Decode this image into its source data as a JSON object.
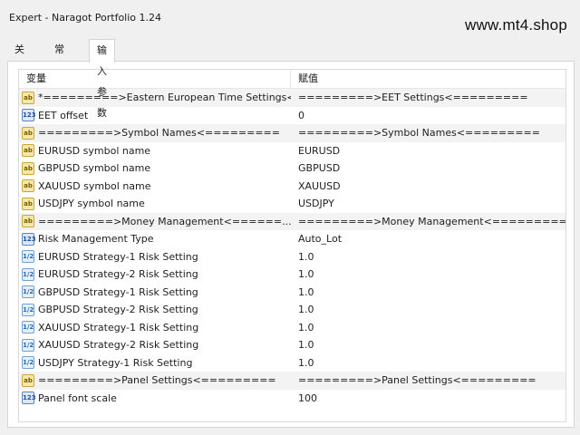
{
  "window": {
    "title": "Expert - Naragot Portfolio 1.24"
  },
  "watermark": "www.mt4.shop",
  "tabs": [
    {
      "label": "关于"
    },
    {
      "label": "常用"
    },
    {
      "label": "输入参数"
    }
  ],
  "table": {
    "headers": {
      "variable": "变量",
      "value": "赋值"
    },
    "rows": [
      {
        "icon": "ab",
        "name": "*=========>Eastern European Time Settings<...",
        "value": "=========>EET Settings<========="
      },
      {
        "icon": "123",
        "name": "EET offset",
        "value": "0"
      },
      {
        "icon": "ab",
        "name": "=========>Symbol Names<=========",
        "value": "=========>Symbol Names<========="
      },
      {
        "icon": "ab",
        "name": "EURUSD symbol name",
        "value": "EURUSD"
      },
      {
        "icon": "ab",
        "name": "GBPUSD symbol name",
        "value": "GBPUSD"
      },
      {
        "icon": "ab",
        "name": "XAUUSD symbol name",
        "value": "XAUUSD"
      },
      {
        "icon": "ab",
        "name": "USDJPY symbol name",
        "value": "USDJPY"
      },
      {
        "icon": "ab",
        "name": "=========>Money Management<======...",
        "value": "=========>Money Management<========="
      },
      {
        "icon": "123",
        "name": "Risk Management Type",
        "value": "Auto_Lot"
      },
      {
        "icon": "1/2",
        "name": "EURUSD Strategy-1 Risk Setting",
        "value": "1.0"
      },
      {
        "icon": "1/2",
        "name": "EURUSD Strategy-2 Risk Setting",
        "value": "1.0"
      },
      {
        "icon": "1/2",
        "name": "GBPUSD Strategy-1 Risk Setting",
        "value": "1.0"
      },
      {
        "icon": "1/2",
        "name": "GBPUSD Strategy-2 Risk Setting",
        "value": "1.0"
      },
      {
        "icon": "1/2",
        "name": "XAUUSD Strategy-1 Risk Setting",
        "value": "1.0"
      },
      {
        "icon": "1/2",
        "name": "XAUUSD Strategy-2 Risk Setting",
        "value": "1.0"
      },
      {
        "icon": "1/2",
        "name": "USDJPY Strategy-1 Risk Setting",
        "value": "1.0"
      },
      {
        "icon": "ab",
        "name": "=========>Panel Settings<=========",
        "value": "=========>Panel Settings<========="
      },
      {
        "icon": "123",
        "name": "Panel font scale",
        "value": "100"
      }
    ]
  }
}
